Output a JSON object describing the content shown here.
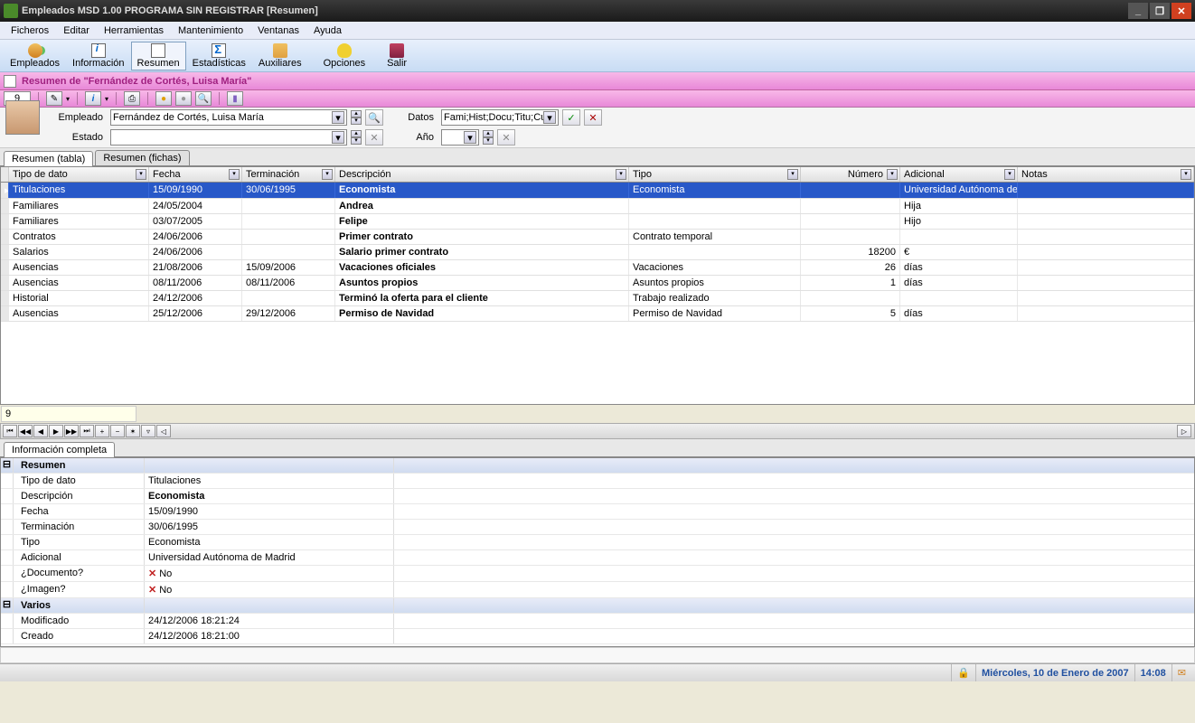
{
  "window": {
    "title": "Empleados MSD 1.00 PROGRAMA SIN REGISTRAR [Resumen]"
  },
  "menubar": [
    "Ficheros",
    "Editar",
    "Herramientas",
    "Mantenimiento",
    "Ventanas",
    "Ayuda"
  ],
  "toolbar1": [
    {
      "label": "Empleados",
      "icon": "emp"
    },
    {
      "label": "Información",
      "icon": "info"
    },
    {
      "label": "Resumen",
      "icon": "res",
      "active": true
    },
    {
      "label": "Estadísticas",
      "icon": "stat"
    },
    {
      "label": "Auxiliares",
      "icon": "aux"
    },
    {
      "label": "Opciones",
      "icon": "opt"
    },
    {
      "label": "Salir",
      "icon": "exit"
    }
  ],
  "pinkbar_title": "Resumen de \"Fernández de Cortés, Luisa María\"",
  "toolbar2_num": "9",
  "filter": {
    "empleado_label": "Empleado",
    "empleado_value": "Fernández de Cortés, Luisa María",
    "datos_label": "Datos",
    "datos_value": "Fami;Hist;Docu;Titu;Curs",
    "estado_label": "Estado",
    "estado_value": "",
    "ano_label": "Año",
    "ano_value": ""
  },
  "tabs": {
    "tabla": "Resumen (tabla)",
    "fichas": "Resumen (fichas)"
  },
  "columns": {
    "tipo": "Tipo de dato",
    "fecha": "Fecha",
    "term": "Terminación",
    "desc": "Descripción",
    "tipo2": "Tipo",
    "num": "Número",
    "adic": "Adicional",
    "notas": "Notas"
  },
  "rows": [
    {
      "tipo": "Titulaciones",
      "fecha": "15/09/1990",
      "term": "30/06/1995",
      "desc": "Economista",
      "tipo2": "Economista",
      "num": "",
      "adic": "Universidad Autónoma de Madrid",
      "notas": "",
      "selected": true
    },
    {
      "tipo": "Familiares",
      "fecha": "24/05/2004",
      "term": "",
      "desc": "Andrea",
      "tipo2": "",
      "num": "",
      "adic": "Hija",
      "notas": ""
    },
    {
      "tipo": "Familiares",
      "fecha": "03/07/2005",
      "term": "",
      "desc": "Felipe",
      "tipo2": "",
      "num": "",
      "adic": "Hijo",
      "notas": ""
    },
    {
      "tipo": "Contratos",
      "fecha": "24/06/2006",
      "term": "",
      "desc": "Primer contrato",
      "tipo2": "Contrato temporal",
      "num": "",
      "adic": "",
      "notas": ""
    },
    {
      "tipo": "Salarios",
      "fecha": "24/06/2006",
      "term": "",
      "desc": "Salario primer contrato",
      "tipo2": "",
      "num": "18200",
      "adic": "€",
      "notas": ""
    },
    {
      "tipo": "Ausencias",
      "fecha": "21/08/2006",
      "term": "15/09/2006",
      "desc": "Vacaciones oficiales",
      "tipo2": "Vacaciones",
      "num": "26",
      "adic": "días",
      "notas": ""
    },
    {
      "tipo": "Ausencias",
      "fecha": "08/11/2006",
      "term": "08/11/2006",
      "desc": "Asuntos propios",
      "tipo2": "Asuntos propios",
      "num": "1",
      "adic": "días",
      "notas": ""
    },
    {
      "tipo": "Historial",
      "fecha": "24/12/2006",
      "term": "",
      "desc": "Terminó la oferta para el cliente",
      "tipo2": "Trabajo realizado",
      "num": "",
      "adic": "",
      "notas": ""
    },
    {
      "tipo": "Ausencias",
      "fecha": "25/12/2006",
      "term": "29/12/2006",
      "desc": "Permiso de Navidad",
      "tipo2": "Permiso de Navidad",
      "num": "5",
      "adic": "días",
      "notas": ""
    }
  ],
  "status_input": "9",
  "infotab": "Información completa",
  "info": {
    "resumen_header": "Resumen",
    "tipo_k": "Tipo de dato",
    "tipo_v": "Titulaciones",
    "desc_k": "Descripción",
    "desc_v": "Economista",
    "fecha_k": "Fecha",
    "fecha_v": "15/09/1990",
    "term_k": "Terminación",
    "term_v": "30/06/1995",
    "tipo2_k": "Tipo",
    "tipo2_v": "Economista",
    "adic_k": "Adicional",
    "adic_v": "Universidad Autónoma de Madrid",
    "doc_k": "¿Documento?",
    "doc_v": "No",
    "img_k": "¿Imagen?",
    "img_v": "No",
    "varios_header": "Varios",
    "mod_k": "Modificado",
    "mod_v": "24/12/2006 18:21:24",
    "crea_k": "Creado",
    "crea_v": "24/12/2006 18:21:00"
  },
  "statusbar": {
    "date": "Miércoles, 10 de Enero de 2007",
    "time": "14:08"
  }
}
